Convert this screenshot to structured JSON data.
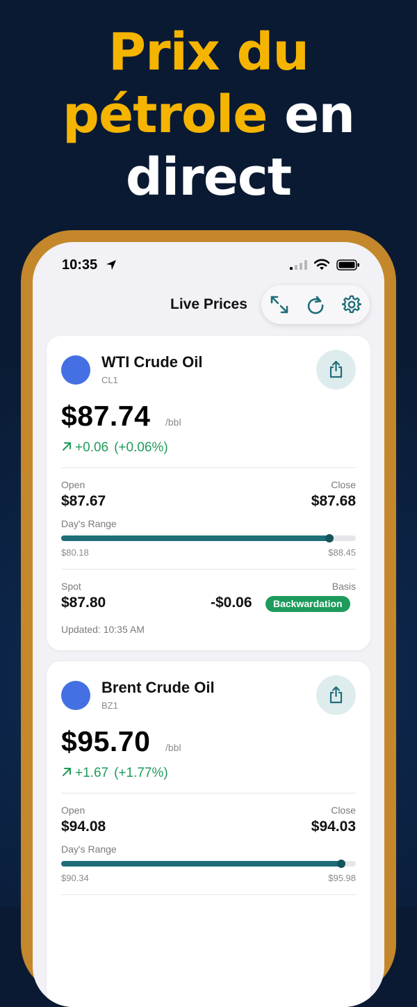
{
  "headline": {
    "line1": "Prix du",
    "line2_highlight": "pétrole",
    "line2_rest": "en",
    "line3": "direct"
  },
  "status_bar": {
    "time": "10:35"
  },
  "nav": {
    "title": "Live Prices"
  },
  "toolbar_icons": [
    "expand-icon",
    "refresh-icon",
    "gear-icon"
  ],
  "cards": [
    {
      "name": "WTI Crude Oil",
      "symbol": "CL1",
      "price": "$87.74",
      "unit": "/bbl",
      "change": "+0.06",
      "change_pct": "(+0.06%)",
      "open_label": "Open",
      "open": "$87.67",
      "close_label": "Close",
      "close": "$87.68",
      "range_label": "Day's Range",
      "range_low": "$80.18",
      "range_high": "$88.45",
      "range_position": 0.91,
      "spot_label": "Spot",
      "spot": "$87.80",
      "basis_label": "Basis",
      "basis": "-$0.06",
      "basis_badge": "Backwardation",
      "updated": "Updated: 10:35 AM"
    },
    {
      "name": "Brent Crude Oil",
      "symbol": "BZ1",
      "price": "$95.70",
      "unit": "/bbl",
      "change": "+1.67",
      "change_pct": "(+1.77%)",
      "open_label": "Open",
      "open": "$94.08",
      "close_label": "Close",
      "close": "$94.03",
      "range_label": "Day's Range",
      "range_low": "$90.34",
      "range_high": "$95.98",
      "range_position": 0.95
    }
  ],
  "colors": {
    "accent_yellow": "#f5b400",
    "frame_gold": "#c4872b",
    "positive_green": "#1f9a5b",
    "bar_teal": "#1e6e78",
    "dot_blue": "#4470e3"
  }
}
